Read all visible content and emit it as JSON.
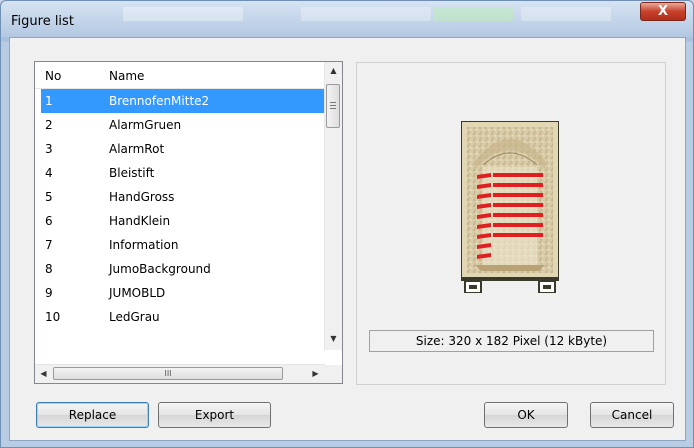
{
  "window": {
    "title": "Figure list",
    "close_glyph": "X"
  },
  "list": {
    "columns": [
      "No",
      "Name"
    ],
    "rows": [
      {
        "no": "1",
        "name": "BrennofenMitte2",
        "selected": true
      },
      {
        "no": "2",
        "name": "AlarmGruen"
      },
      {
        "no": "3",
        "name": "AlarmRot"
      },
      {
        "no": "4",
        "name": "Bleistift"
      },
      {
        "no": "5",
        "name": "HandGross"
      },
      {
        "no": "6",
        "name": "HandKlein"
      },
      {
        "no": "7",
        "name": "Information"
      },
      {
        "no": "8",
        "name": "JumoBackground"
      },
      {
        "no": "9",
        "name": "JUMOBLD"
      },
      {
        "no": "10",
        "name": "LedGrau"
      }
    ],
    "scroll_up": "▲",
    "scroll_down": "▼",
    "scroll_left": "◀",
    "scroll_right": "▶",
    "hthumb_grip": "III"
  },
  "preview": {
    "size_text": "Size: 320 x 182 Pixel (12 kByte)"
  },
  "buttons": {
    "replace": "Replace",
    "export": "Export",
    "ok": "OK",
    "cancel": "Cancel"
  },
  "colors": {
    "selection": "#3399ff",
    "stripe": "#e02020",
    "frame": "#3a3a2a"
  }
}
